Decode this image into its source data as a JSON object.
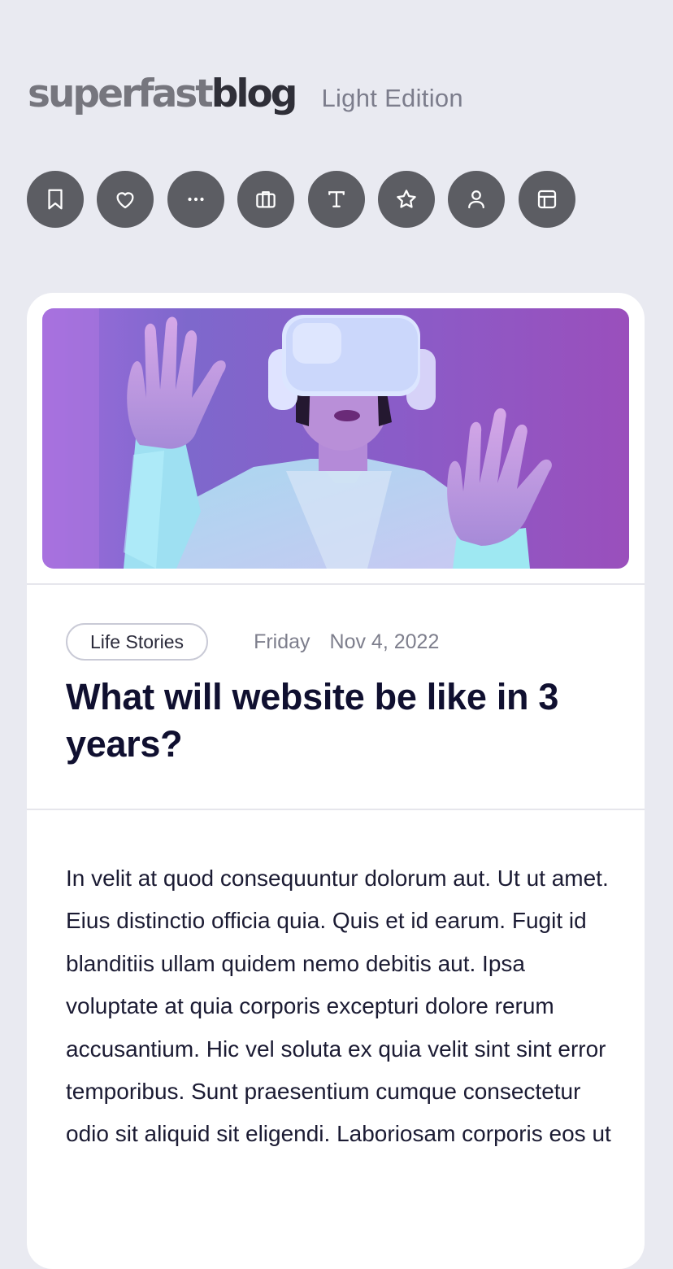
{
  "header": {
    "logo_part1": "superfast",
    "logo_part2": "blog",
    "edition": "Light Edition"
  },
  "toolbar": {
    "icons": [
      "bookmark-icon",
      "heart-icon",
      "more-icon",
      "briefcase-icon",
      "text-icon",
      "star-icon",
      "user-icon",
      "layout-icon"
    ]
  },
  "post": {
    "category": "Life Stories",
    "day": "Friday",
    "date": "Nov 4, 2022",
    "title": "What will website be like in 3 years?",
    "body": "In velit at quod consequuntur dolorum aut. Ut ut amet. Eius distinctio officia quia. Quis et id earum. Fugit id blanditiis ullam quidem nemo debitis aut. Ipsa voluptate at quia corporis excepturi dolore rerum accusantium. Hic vel soluta ex quia velit sint sint error temporibus. Sunt praesentium cumque consectetur odio sit aliquid sit eligendi. Laboriosam corporis eos ut"
  },
  "colors": {
    "page_bg": "#e9eaf1",
    "icon_bg": "#5c5d63",
    "card_bg": "#ffffff",
    "hero_purple": "#8a5cc8"
  }
}
